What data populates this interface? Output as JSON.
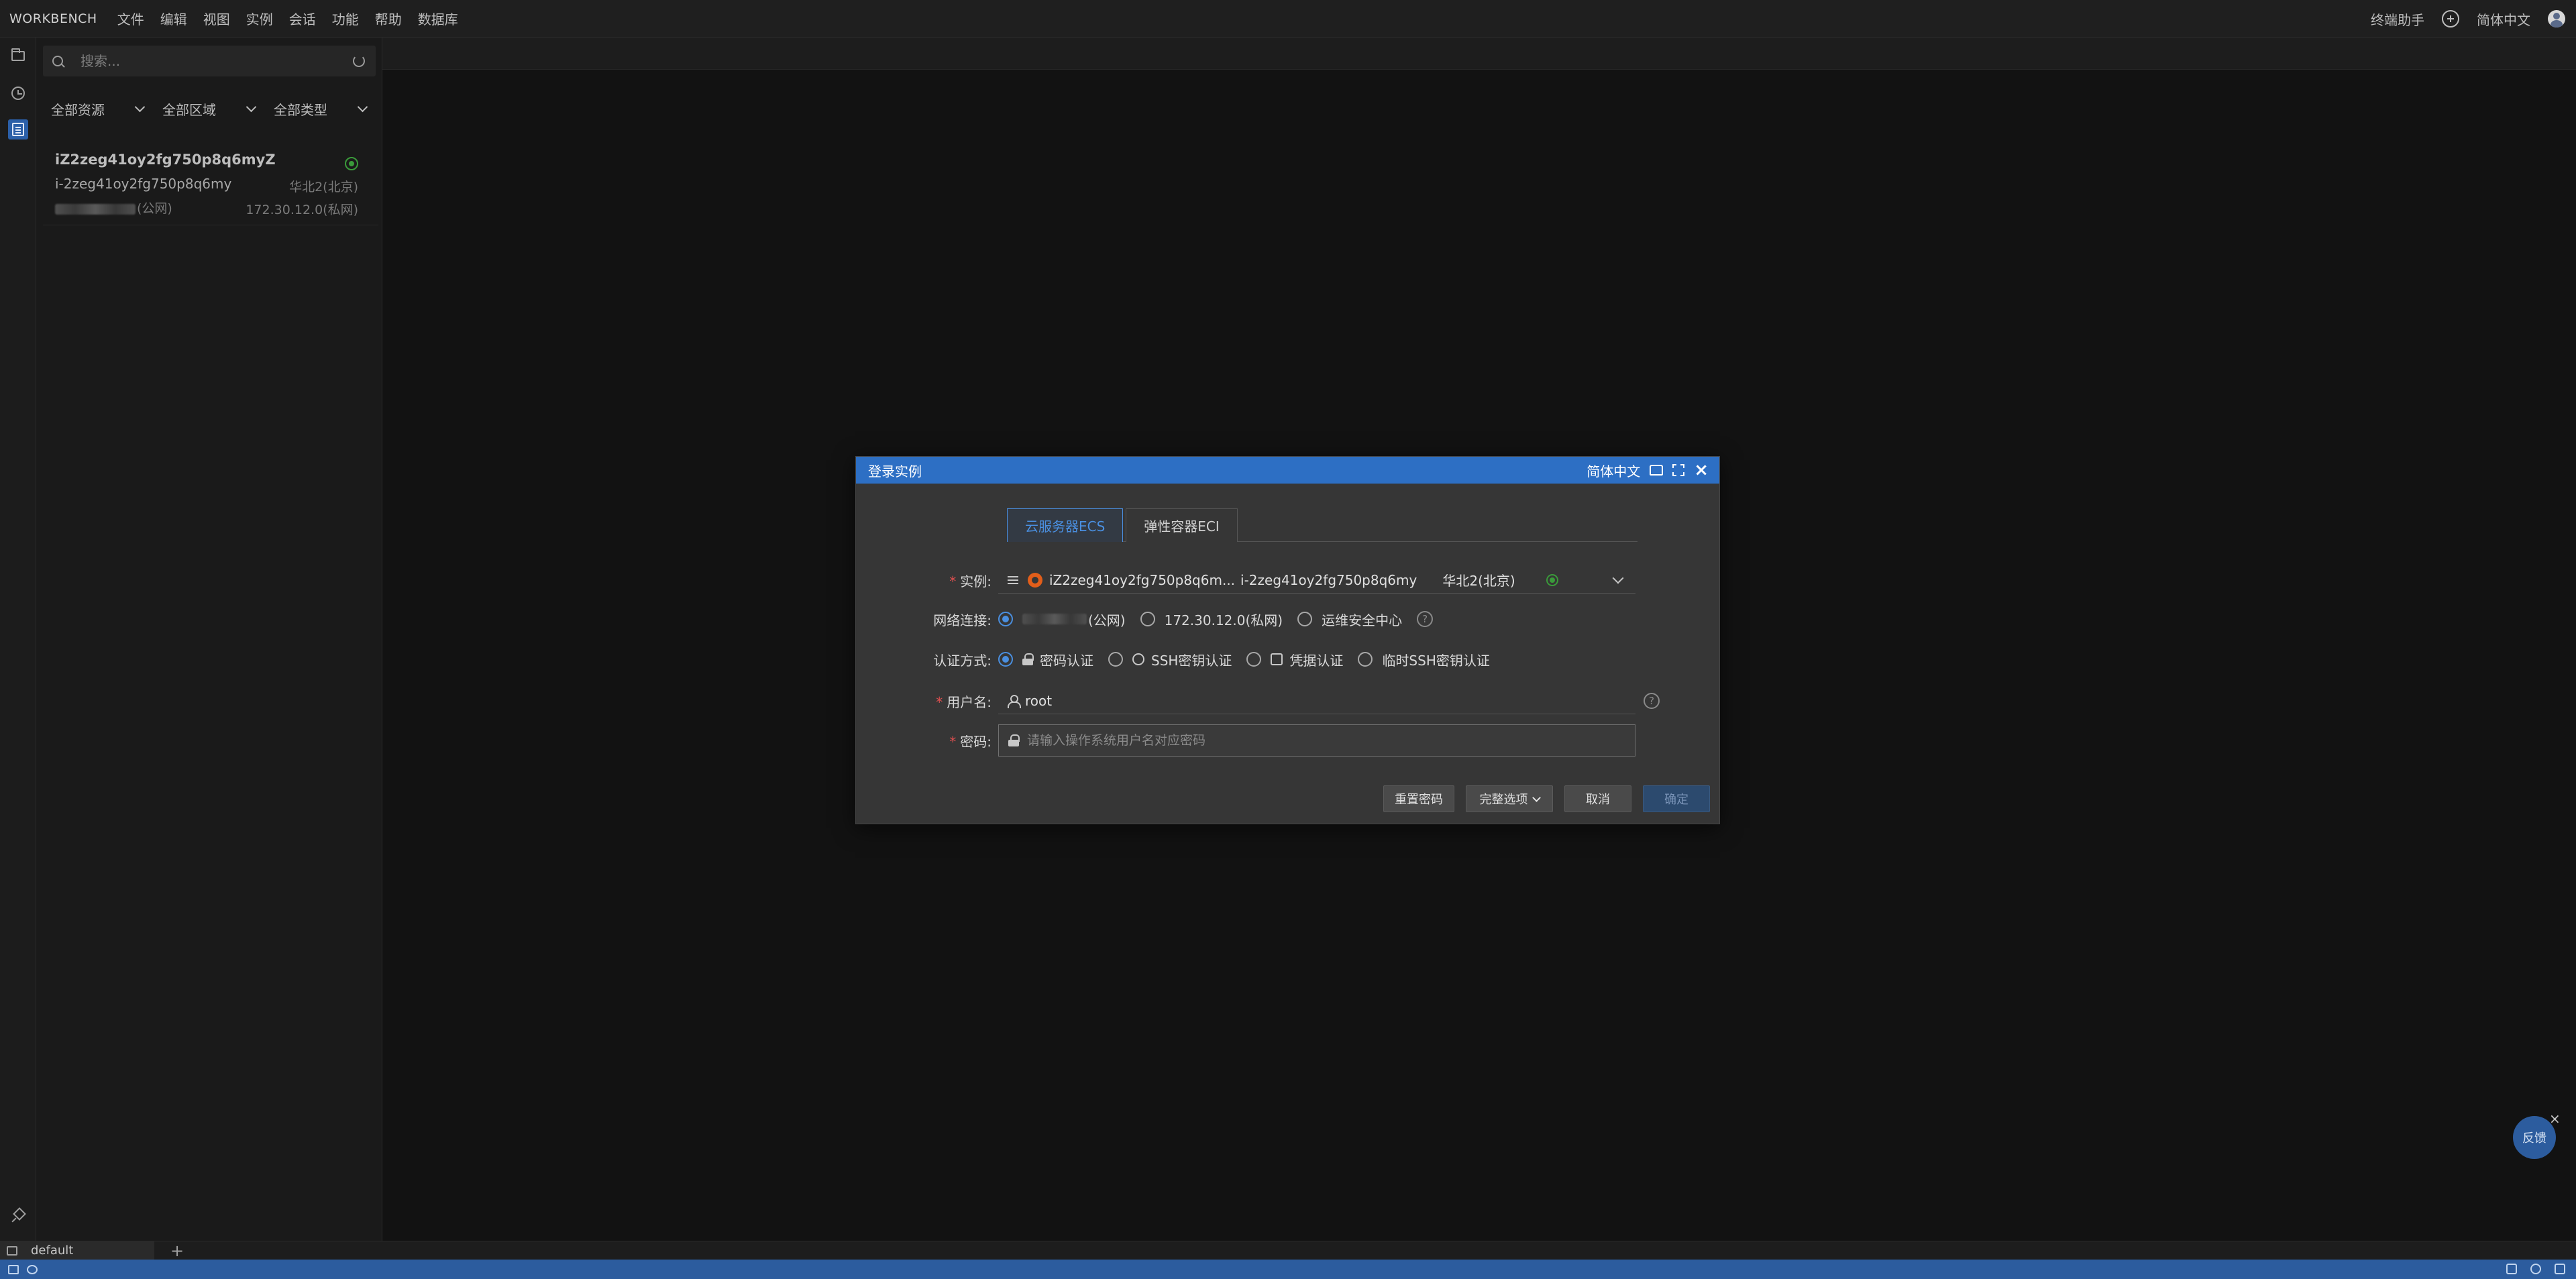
{
  "menubar": {
    "brand": "WORKBENCH",
    "items": [
      "文件",
      "编辑",
      "视图",
      "实例",
      "会话",
      "功能",
      "帮助",
      "数据库"
    ],
    "assistant": "终端助手",
    "language": "简体中文"
  },
  "sidebar": {
    "search_placeholder": "搜索...",
    "filters": [
      "全部资源",
      "全部区域",
      "全部类型"
    ],
    "instance": {
      "name": "iZ2zeg41oy2fg750p8q6myZ",
      "id": "i-2zeg41oy2fg750p8q6my",
      "region": "华北2(北京)",
      "public_suffix": "(公网)",
      "private_ip": "172.30.12.0(私网)"
    }
  },
  "terminal_tabs": {
    "default_label": "default",
    "add_label": "+"
  },
  "feedback": {
    "label": "反馈",
    "close": "×"
  },
  "modal": {
    "title": "登录实例",
    "language": "简体中文",
    "close": "×",
    "tabs": [
      "云服务器ECS",
      "弹性容器ECI"
    ],
    "instance_label": "实例:",
    "instance_name": "iZ2zeg41oy2fg750p8q6m...",
    "instance_id": "i-2zeg41oy2fg750p8q6my",
    "instance_region": "华北2(北京)",
    "network_label": "网络连接:",
    "network_options": [
      "(公网)",
      "172.30.12.0(私网)",
      "运维安全中心"
    ],
    "auth_label": "认证方式:",
    "auth_options": [
      "密码认证",
      "SSH密钥认证",
      "凭据认证",
      "临时SSH密钥认证"
    ],
    "username_label": "用户名:",
    "username_value": "root",
    "password_label": "密码:",
    "password_placeholder": "请输入操作系统用户名对应密码",
    "buttons": {
      "reset_password": "重置密码",
      "full_options": "完整选项",
      "cancel": "取消",
      "confirm": "确定"
    }
  },
  "colors": {
    "accent": "#2d6fc4",
    "statusbar": "#2c5c9e",
    "online": "#3a9a3a"
  }
}
